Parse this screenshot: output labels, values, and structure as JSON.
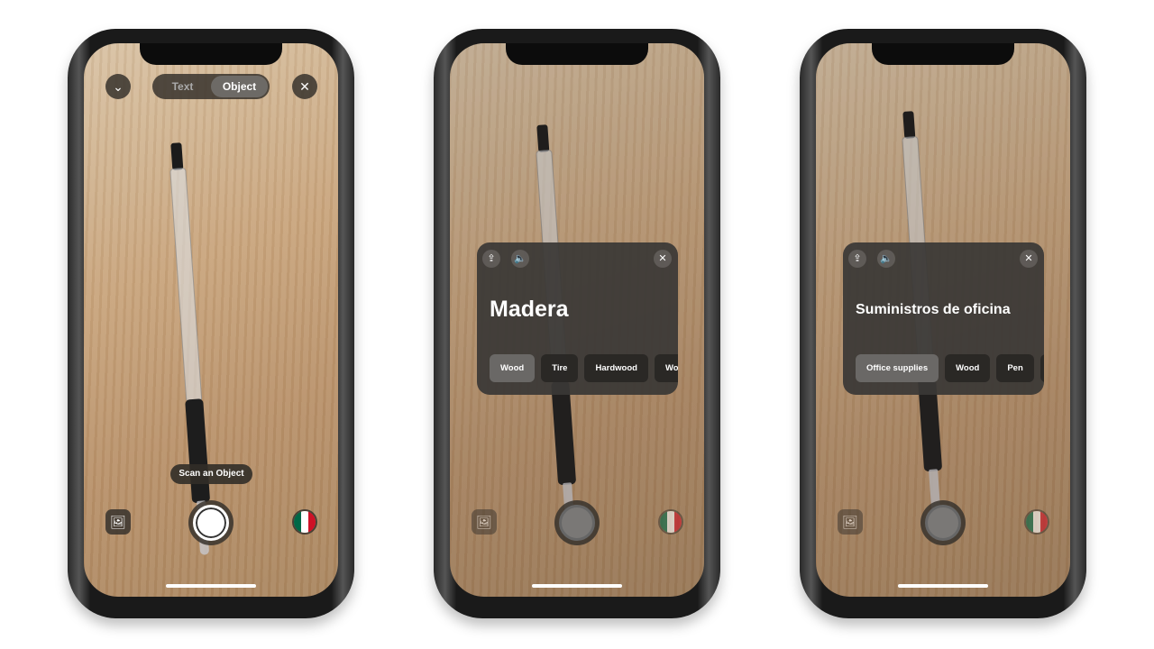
{
  "phones": [
    {
      "mode_toggle": {
        "options": [
          "Text",
          "Object"
        ],
        "selected": "Object"
      },
      "hint": "Scan an Object",
      "language_flag": "mexico"
    },
    {
      "result_card": {
        "title": "Madera",
        "suggestions": [
          "Wood",
          "Tire",
          "Hardwood",
          "Woo"
        ],
        "selected": "Wood"
      },
      "language_flag": "mexico"
    },
    {
      "result_card": {
        "title": "Suministros de oficina",
        "suggestions": [
          "Office supplies",
          "Wood",
          "Pen",
          ""
        ],
        "selected": "Office supplies"
      },
      "language_flag": "mexico"
    }
  ],
  "colors": {
    "overlay": "#3a3836",
    "chip_selected": "#6a6866",
    "flag_green": "#006847",
    "flag_red": "#ce1126"
  }
}
